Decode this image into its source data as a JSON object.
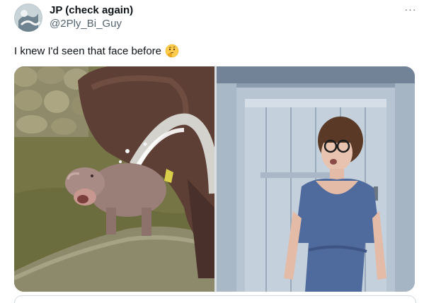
{
  "author": {
    "display_name": "JP (check again)",
    "handle": "@2Ply_Bi_Guy"
  },
  "tweet": {
    "text": "I knew I'd seen that face before",
    "emoji": "thinking-face-icon"
  },
  "more_menu": {
    "label": "···"
  },
  "media": {
    "count": 2,
    "photos": [
      {
        "subject": "baby pygmy hippo being sprayed with water beside adult hippo"
      },
      {
        "subject": "woman in glasses and blue dress grimacing in front of a weathered door"
      }
    ]
  },
  "colors": {
    "text_primary": "#0f1419",
    "text_secondary": "#536471",
    "border": "#cfd9de"
  }
}
